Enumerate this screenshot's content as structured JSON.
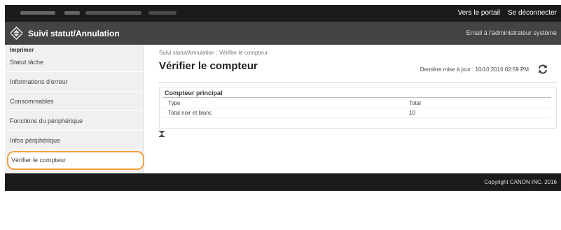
{
  "topbar": {
    "portal_link": "Vers le portail",
    "logout_link": "Se déconnecter"
  },
  "header": {
    "app_title": "Suivi statut/Annulation",
    "email_link": "Email à l'administrateur système"
  },
  "sidebar": {
    "group_label": "Imprimer",
    "items": [
      {
        "label": "Statut tâche"
      },
      {
        "label": "Informations d'erreur"
      },
      {
        "label": "Consommables"
      },
      {
        "label": "Fonctions du périphérique"
      },
      {
        "label": "Infos périphérique"
      },
      {
        "label": "Vérifier le compteur",
        "selected": true
      }
    ]
  },
  "main": {
    "breadcrumb": "Suivi statut/Annulation : Vérifier le compteur",
    "title": "Vérifier le compteur",
    "last_updated": "Dernière mise à jour : 10/10 2016 02:59 PM",
    "counter": {
      "header": "Compteur principal",
      "column_type": "Type",
      "column_total": "Total",
      "rows": [
        {
          "type": "Total noir et blanc",
          "total": "10"
        }
      ]
    }
  },
  "footer": {
    "copyright": "Copyright CANON INC. 2016"
  },
  "colors": {
    "topbar": "#1b1b1b",
    "header": "#444444",
    "sidebar_bg": "#f0f0f0",
    "selected_outline": "#f0a040"
  }
}
